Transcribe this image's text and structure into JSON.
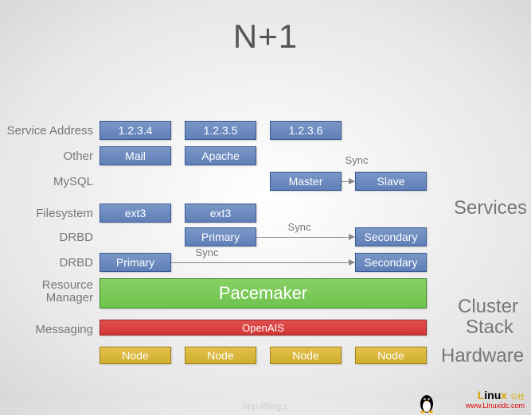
{
  "title": "N+1",
  "row_labels": {
    "service_address": "Service Address",
    "other": "Other",
    "mysql": "MySQL",
    "filesystem": "Filesystem",
    "drbd1": "DRBD",
    "drbd2": "DRBD",
    "resource_manager_a": "Resource",
    "resource_manager_b": "Manager",
    "messaging": "Messaging"
  },
  "side_labels": {
    "services": "Services",
    "cluster_a": "Cluster",
    "cluster_b": "Stack",
    "hardware": "Hardware"
  },
  "boxes": {
    "addr1": "1.2.3.4",
    "addr2": "1.2.3.5",
    "addr3": "1.2.3.6",
    "mail": "Mail",
    "apache": "Apache",
    "master": "Master",
    "slave": "Slave",
    "ext3_a": "ext3",
    "ext3_b": "ext3",
    "primary1": "Primary",
    "secondary1": "Secondary",
    "primary2": "Primary",
    "secondary2": "Secondary",
    "pacemaker": "Pacemaker",
    "openais": "OpenAIS",
    "node": "Node"
  },
  "sync": "Sync",
  "watermark": {
    "brand_a": "L",
    "brand_b": "inu",
    "brand_c": "x",
    "brand_cn": "公社",
    "url": "www.Linuxidc.com",
    "blog": "http://blog.c"
  },
  "chart_data": {
    "type": "table",
    "title": "N+1",
    "layers": [
      {
        "layer": "Service Address",
        "group": "Services",
        "nodes": [
          "1.2.3.4",
          "1.2.3.5",
          "1.2.3.6",
          null
        ]
      },
      {
        "layer": "Other",
        "group": "Services",
        "nodes": [
          "Mail",
          "Apache",
          null,
          null
        ]
      },
      {
        "layer": "MySQL",
        "group": "Services",
        "nodes": [
          null,
          null,
          "Master",
          "Slave"
        ],
        "sync": {
          "from": "Master",
          "to": "Slave"
        }
      },
      {
        "layer": "Filesystem",
        "group": "Services",
        "nodes": [
          "ext3",
          "ext3",
          null,
          null
        ]
      },
      {
        "layer": "DRBD",
        "group": "Services",
        "nodes": [
          null,
          "Primary",
          null,
          "Secondary"
        ],
        "sync": {
          "from": "Primary",
          "to": "Secondary"
        }
      },
      {
        "layer": "DRBD",
        "group": "Services",
        "nodes": [
          "Primary",
          null,
          null,
          "Secondary"
        ],
        "sync": {
          "from": "Primary",
          "to": "Secondary"
        }
      },
      {
        "layer": "Resource Manager",
        "group": "Cluster Stack",
        "nodes": [
          "Pacemaker"
        ],
        "span": 4
      },
      {
        "layer": "Messaging",
        "group": "Cluster Stack",
        "nodes": [
          "OpenAIS"
        ],
        "span": 4
      },
      {
        "layer": "Hardware",
        "group": "Hardware",
        "nodes": [
          "Node",
          "Node",
          "Node",
          "Node"
        ]
      }
    ]
  }
}
